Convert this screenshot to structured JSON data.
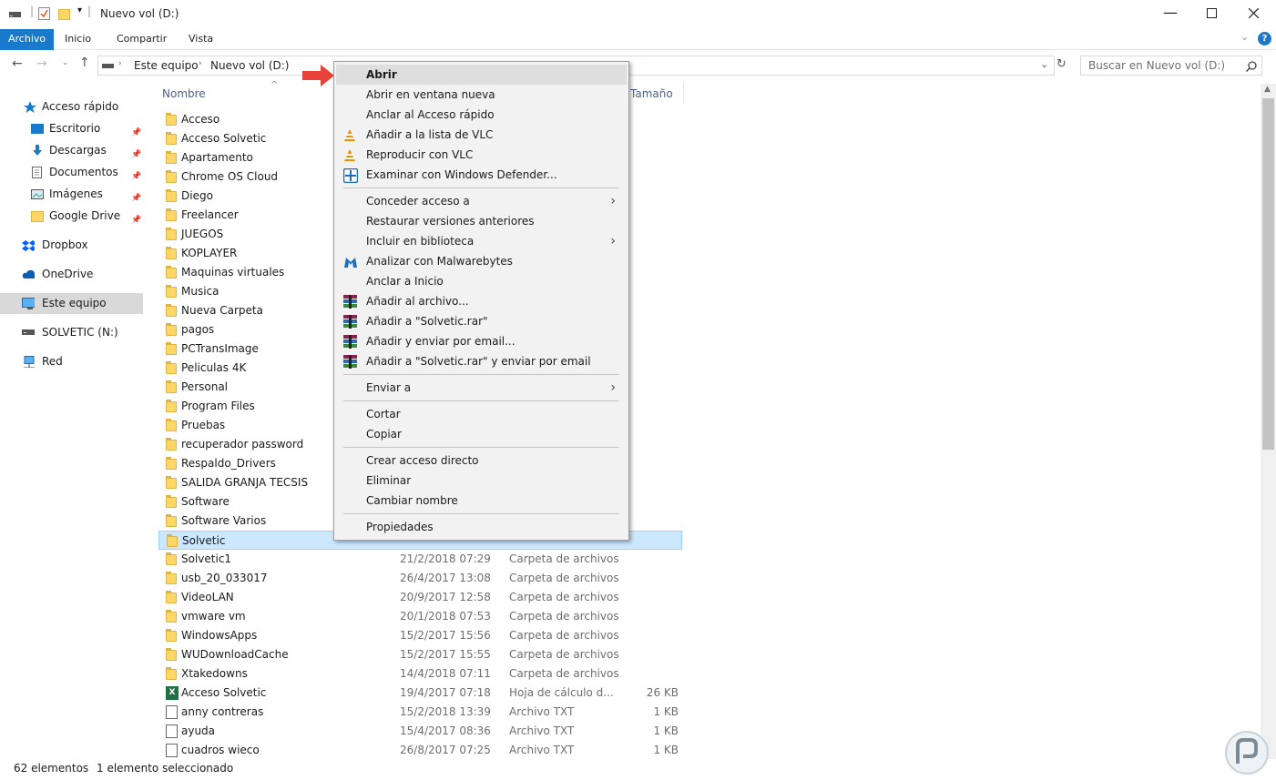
{
  "window": {
    "title": "Nuevo vol (D:)"
  },
  "ribbon": {
    "tabs": [
      "Archivo",
      "Inicio",
      "Compartir",
      "Vista"
    ]
  },
  "address": {
    "crumbs": [
      "Este equipo",
      "Nuevo vol (D:)"
    ],
    "search_placeholder": "Buscar en Nuevo vol (D:)"
  },
  "sidebar": {
    "items": [
      {
        "label": "Acceso rápido",
        "icon": "star-icon"
      },
      {
        "label": "Escritorio",
        "icon": "desktop-icon",
        "pinned": true
      },
      {
        "label": "Descargas",
        "icon": "download-icon",
        "pinned": true
      },
      {
        "label": "Documentos",
        "icon": "document-icon",
        "pinned": true
      },
      {
        "label": "Imágenes",
        "icon": "pictures-icon",
        "pinned": true
      },
      {
        "label": "Google Drive",
        "icon": "folder-icon",
        "pinned": true
      },
      {
        "label": "Dropbox",
        "icon": "dropbox-icon"
      },
      {
        "label": "OneDrive",
        "icon": "cloud-icon"
      },
      {
        "label": "Este equipo",
        "icon": "computer-icon",
        "selected": true
      },
      {
        "label": "SOLVETIC (N:)",
        "icon": "drive-icon"
      },
      {
        "label": "Red",
        "icon": "network-icon"
      }
    ]
  },
  "columns": {
    "name": "Nombre",
    "size": "Tamaño"
  },
  "files": [
    {
      "name": "Acceso",
      "date": "",
      "type": "",
      "size": ""
    },
    {
      "name": "Acceso Solvetic",
      "date": "",
      "type": "",
      "size": ""
    },
    {
      "name": "Apartamento",
      "date": "",
      "type": "",
      "size": ""
    },
    {
      "name": "Chrome OS Cloud",
      "date": "",
      "type": "",
      "size": ""
    },
    {
      "name": "Diego",
      "date": "",
      "type": "",
      "size": ""
    },
    {
      "name": "Freelancer",
      "date": "",
      "type": "",
      "size": ""
    },
    {
      "name": "JUEGOS",
      "date": "",
      "type": "",
      "size": ""
    },
    {
      "name": "KOPLAYER",
      "date": "",
      "type": "",
      "size": ""
    },
    {
      "name": "Maquinas virtuales",
      "date": "",
      "type": "",
      "size": ""
    },
    {
      "name": "Musica",
      "date": "",
      "type": "",
      "size": ""
    },
    {
      "name": "Nueva Carpeta",
      "date": "",
      "type": "",
      "size": ""
    },
    {
      "name": "pagos",
      "date": "",
      "type": "",
      "size": ""
    },
    {
      "name": "PCTransImage",
      "date": "",
      "type": "",
      "size": ""
    },
    {
      "name": "Peliculas 4K",
      "date": "",
      "type": "",
      "size": ""
    },
    {
      "name": "Personal",
      "date": "",
      "type": "",
      "size": ""
    },
    {
      "name": "Program Files",
      "date": "",
      "type": "",
      "size": ""
    },
    {
      "name": "Pruebas",
      "date": "",
      "type": "",
      "size": ""
    },
    {
      "name": "recuperador password",
      "date": "",
      "type": "",
      "size": ""
    },
    {
      "name": "Respaldo_Drivers",
      "date": "",
      "type": "",
      "size": ""
    },
    {
      "name": "SALIDA GRANJA TECSIS",
      "date": "",
      "type": "",
      "size": ""
    },
    {
      "name": "Software",
      "date": "",
      "type": "",
      "size": ""
    },
    {
      "name": "Software Varios",
      "date": "",
      "type": "",
      "size": ""
    },
    {
      "name": "Solvetic",
      "date": "",
      "type": "",
      "size": "",
      "selected": true
    },
    {
      "name": "Solvetic1",
      "date": "21/2/2018 07:29",
      "type": "Carpeta de archivos",
      "size": ""
    },
    {
      "name": "usb_20_033017",
      "date": "26/4/2017 13:08",
      "type": "Carpeta de archivos",
      "size": ""
    },
    {
      "name": "VideoLAN",
      "date": "20/9/2017 12:58",
      "type": "Carpeta de archivos",
      "size": ""
    },
    {
      "name": "vmware vm",
      "date": "20/1/2018 07:53",
      "type": "Carpeta de archivos",
      "size": ""
    },
    {
      "name": "WindowsApps",
      "date": "15/2/2017 15:56",
      "type": "Carpeta de archivos",
      "size": ""
    },
    {
      "name": "WUDownloadCache",
      "date": "15/2/2017 15:55",
      "type": "Carpeta de archivos",
      "size": ""
    },
    {
      "name": "Xtakedowns",
      "date": "14/4/2018 07:11",
      "type": "Carpeta de archivos",
      "size": ""
    },
    {
      "name": "Acceso Solvetic",
      "date": "19/4/2017 07:18",
      "type": "Hoja de cálculo d...",
      "size": "26 KB",
      "kind": "xls"
    },
    {
      "name": "anny contreras",
      "date": "15/2/2018 13:39",
      "type": "Archivo TXT",
      "size": "1 KB",
      "kind": "txt"
    },
    {
      "name": "ayuda",
      "date": "15/4/2017 08:36",
      "type": "Archivo TXT",
      "size": "1 KB",
      "kind": "txt"
    },
    {
      "name": "cuadros wieco",
      "date": "26/8/2017 07:25",
      "type": "Archivo TXT",
      "size": "1 KB",
      "kind": "txt"
    }
  ],
  "context_menu": {
    "groups": [
      [
        {
          "label": "Abrir",
          "highlight": true
        },
        {
          "label": "Abrir en ventana nueva"
        },
        {
          "label": "Anclar al Acceso rápido"
        },
        {
          "label": "Añadir a la lista de VLC",
          "icon": "vlc-icon"
        },
        {
          "label": "Reproducir con VLC",
          "icon": "vlc-icon"
        },
        {
          "label": "Examinar con Windows Defender...",
          "icon": "defender-icon"
        }
      ],
      [
        {
          "label": "Conceder acceso a",
          "submenu": true
        },
        {
          "label": "Restaurar versiones anteriores"
        },
        {
          "label": "Incluir en biblioteca",
          "submenu": true
        },
        {
          "label": "Analizar con Malwarebytes",
          "icon": "malwarebytes-icon"
        },
        {
          "label": "Anclar a Inicio"
        },
        {
          "label": "Añadir al archivo...",
          "icon": "winrar-icon"
        },
        {
          "label": "Añadir a \"Solvetic.rar\"",
          "icon": "winrar-icon"
        },
        {
          "label": "Añadir y enviar por email...",
          "icon": "winrar-icon"
        },
        {
          "label": "Añadir a \"Solvetic.rar\" y enviar por email",
          "icon": "winrar-icon"
        }
      ],
      [
        {
          "label": "Enviar a",
          "submenu": true
        }
      ],
      [
        {
          "label": "Cortar"
        },
        {
          "label": "Copiar"
        }
      ],
      [
        {
          "label": "Crear acceso directo"
        },
        {
          "label": "Eliminar"
        },
        {
          "label": "Cambiar nombre"
        }
      ],
      [
        {
          "label": "Propiedades"
        }
      ]
    ]
  },
  "status": {
    "count": "62 elementos",
    "selection": "1 elemento seleccionado"
  },
  "colors": {
    "accent": "#1979ca",
    "selection": "#cce8ff",
    "folder": "#ffd766",
    "arrow": "#e8413a"
  }
}
